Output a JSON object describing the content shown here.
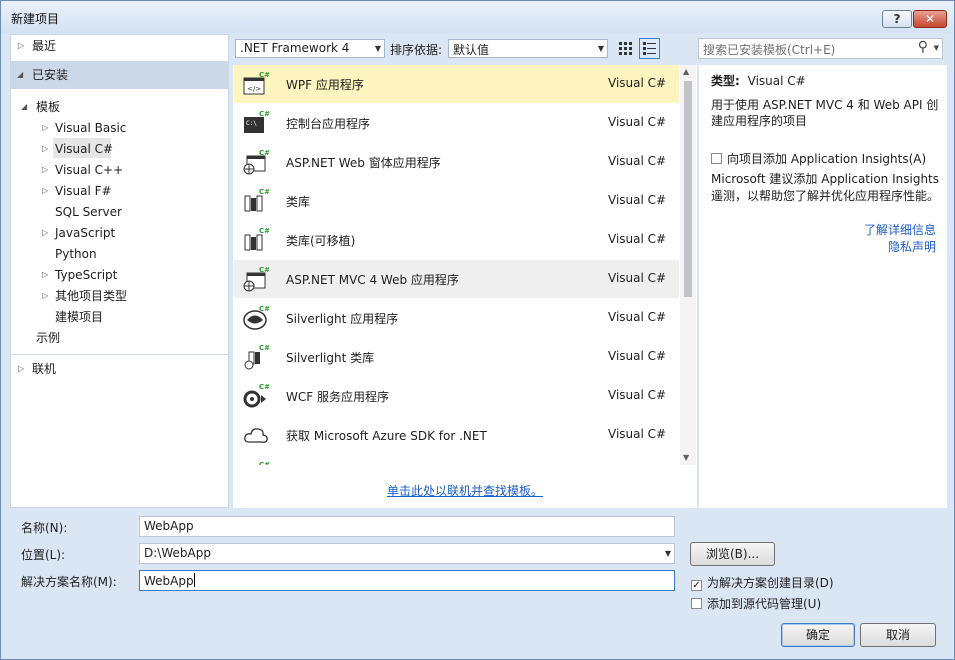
{
  "window": {
    "title": "新建项目",
    "help_label": "?",
    "close_label": "✕"
  },
  "tree": {
    "recent": "最近",
    "installed": "已安装",
    "templates": "模板",
    "children": [
      "Visual Basic",
      "Visual C#",
      "Visual C++",
      "Visual F#",
      "SQL Server",
      "JavaScript",
      "Python",
      "TypeScript",
      "其他项目类型",
      "建模项目"
    ],
    "samples": "示例",
    "online": "联机"
  },
  "toolbar": {
    "framework": ".NET Framework 4",
    "sort_label": "排序依据:",
    "sort_value": "默认值",
    "search_placeholder": "搜索已安装模板(Ctrl+E)"
  },
  "templates": [
    {
      "name": "WPF 应用程序",
      "lang": "Visual C#"
    },
    {
      "name": "控制台应用程序",
      "lang": "Visual C#"
    },
    {
      "name": "ASP.NET Web 窗体应用程序",
      "lang": "Visual C#"
    },
    {
      "name": "类库",
      "lang": "Visual C#"
    },
    {
      "name": "类库(可移植)",
      "lang": "Visual C#"
    },
    {
      "name": "ASP.NET MVC 4 Web 应用程序",
      "lang": "Visual C#"
    },
    {
      "name": "Silverlight 应用程序",
      "lang": "Visual C#"
    },
    {
      "name": "Silverlight 类库",
      "lang": "Visual C#"
    },
    {
      "name": "WCF 服务应用程序",
      "lang": "Visual C#"
    },
    {
      "name": "获取 Microsoft Azure SDK for .NET",
      "lang": "Visual C#"
    }
  ],
  "online_link": "单击此处以联机并查找模板。",
  "details": {
    "type_label": "类型:",
    "type_value": "Visual C#",
    "description": "用于使用 ASP.NET MVC 4 和 Web API 创建应用程序的项目",
    "insights_checkbox": "向项目添加 Application Insights(A)",
    "insights_note": "Microsoft 建议添加 Application Insights 遥测，以帮助您了解并优化应用程序性能。",
    "learn_more": "了解详细信息",
    "privacy": "隐私声明"
  },
  "form": {
    "name_label": "名称(N):",
    "name_value": "WebApp",
    "location_label": "位置(L):",
    "location_value": "D:\\WebApp",
    "solution_label": "解决方案名称(M):",
    "solution_value": "WebApp",
    "browse": "浏览(B)...",
    "create_dir": "为解决方案创建目录(D)",
    "create_dir_checked": true,
    "source_control": "添加到源代码管理(U)",
    "source_control_checked": false,
    "ok": "确定",
    "cancel": "取消"
  }
}
